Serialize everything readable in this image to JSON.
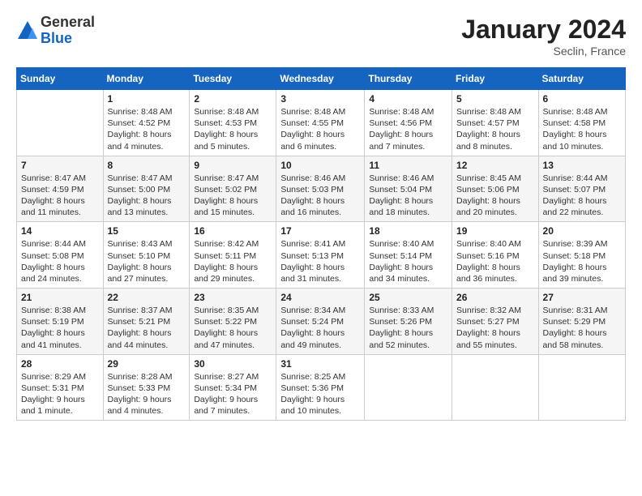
{
  "logo": {
    "general": "General",
    "blue": "Blue"
  },
  "title": "January 2024",
  "location": "Seclin, France",
  "days_of_week": [
    "Sunday",
    "Monday",
    "Tuesday",
    "Wednesday",
    "Thursday",
    "Friday",
    "Saturday"
  ],
  "weeks": [
    [
      {
        "day": "",
        "info": ""
      },
      {
        "day": "1",
        "info": "Sunrise: 8:48 AM\nSunset: 4:52 PM\nDaylight: 8 hours\nand 4 minutes."
      },
      {
        "day": "2",
        "info": "Sunrise: 8:48 AM\nSunset: 4:53 PM\nDaylight: 8 hours\nand 5 minutes."
      },
      {
        "day": "3",
        "info": "Sunrise: 8:48 AM\nSunset: 4:55 PM\nDaylight: 8 hours\nand 6 minutes."
      },
      {
        "day": "4",
        "info": "Sunrise: 8:48 AM\nSunset: 4:56 PM\nDaylight: 8 hours\nand 7 minutes."
      },
      {
        "day": "5",
        "info": "Sunrise: 8:48 AM\nSunset: 4:57 PM\nDaylight: 8 hours\nand 8 minutes."
      },
      {
        "day": "6",
        "info": "Sunrise: 8:48 AM\nSunset: 4:58 PM\nDaylight: 8 hours\nand 10 minutes."
      }
    ],
    [
      {
        "day": "7",
        "info": "Sunrise: 8:47 AM\nSunset: 4:59 PM\nDaylight: 8 hours\nand 11 minutes."
      },
      {
        "day": "8",
        "info": "Sunrise: 8:47 AM\nSunset: 5:00 PM\nDaylight: 8 hours\nand 13 minutes."
      },
      {
        "day": "9",
        "info": "Sunrise: 8:47 AM\nSunset: 5:02 PM\nDaylight: 8 hours\nand 15 minutes."
      },
      {
        "day": "10",
        "info": "Sunrise: 8:46 AM\nSunset: 5:03 PM\nDaylight: 8 hours\nand 16 minutes."
      },
      {
        "day": "11",
        "info": "Sunrise: 8:46 AM\nSunset: 5:04 PM\nDaylight: 8 hours\nand 18 minutes."
      },
      {
        "day": "12",
        "info": "Sunrise: 8:45 AM\nSunset: 5:06 PM\nDaylight: 8 hours\nand 20 minutes."
      },
      {
        "day": "13",
        "info": "Sunrise: 8:44 AM\nSunset: 5:07 PM\nDaylight: 8 hours\nand 22 minutes."
      }
    ],
    [
      {
        "day": "14",
        "info": "Sunrise: 8:44 AM\nSunset: 5:08 PM\nDaylight: 8 hours\nand 24 minutes."
      },
      {
        "day": "15",
        "info": "Sunrise: 8:43 AM\nSunset: 5:10 PM\nDaylight: 8 hours\nand 27 minutes."
      },
      {
        "day": "16",
        "info": "Sunrise: 8:42 AM\nSunset: 5:11 PM\nDaylight: 8 hours\nand 29 minutes."
      },
      {
        "day": "17",
        "info": "Sunrise: 8:41 AM\nSunset: 5:13 PM\nDaylight: 8 hours\nand 31 minutes."
      },
      {
        "day": "18",
        "info": "Sunrise: 8:40 AM\nSunset: 5:14 PM\nDaylight: 8 hours\nand 34 minutes."
      },
      {
        "day": "19",
        "info": "Sunrise: 8:40 AM\nSunset: 5:16 PM\nDaylight: 8 hours\nand 36 minutes."
      },
      {
        "day": "20",
        "info": "Sunrise: 8:39 AM\nSunset: 5:18 PM\nDaylight: 8 hours\nand 39 minutes."
      }
    ],
    [
      {
        "day": "21",
        "info": "Sunrise: 8:38 AM\nSunset: 5:19 PM\nDaylight: 8 hours\nand 41 minutes."
      },
      {
        "day": "22",
        "info": "Sunrise: 8:37 AM\nSunset: 5:21 PM\nDaylight: 8 hours\nand 44 minutes."
      },
      {
        "day": "23",
        "info": "Sunrise: 8:35 AM\nSunset: 5:22 PM\nDaylight: 8 hours\nand 47 minutes."
      },
      {
        "day": "24",
        "info": "Sunrise: 8:34 AM\nSunset: 5:24 PM\nDaylight: 8 hours\nand 49 minutes."
      },
      {
        "day": "25",
        "info": "Sunrise: 8:33 AM\nSunset: 5:26 PM\nDaylight: 8 hours\nand 52 minutes."
      },
      {
        "day": "26",
        "info": "Sunrise: 8:32 AM\nSunset: 5:27 PM\nDaylight: 8 hours\nand 55 minutes."
      },
      {
        "day": "27",
        "info": "Sunrise: 8:31 AM\nSunset: 5:29 PM\nDaylight: 8 hours\nand 58 minutes."
      }
    ],
    [
      {
        "day": "28",
        "info": "Sunrise: 8:29 AM\nSunset: 5:31 PM\nDaylight: 9 hours\nand 1 minute."
      },
      {
        "day": "29",
        "info": "Sunrise: 8:28 AM\nSunset: 5:33 PM\nDaylight: 9 hours\nand 4 minutes."
      },
      {
        "day": "30",
        "info": "Sunrise: 8:27 AM\nSunset: 5:34 PM\nDaylight: 9 hours\nand 7 minutes."
      },
      {
        "day": "31",
        "info": "Sunrise: 8:25 AM\nSunset: 5:36 PM\nDaylight: 9 hours\nand 10 minutes."
      },
      {
        "day": "",
        "info": ""
      },
      {
        "day": "",
        "info": ""
      },
      {
        "day": "",
        "info": ""
      }
    ]
  ]
}
